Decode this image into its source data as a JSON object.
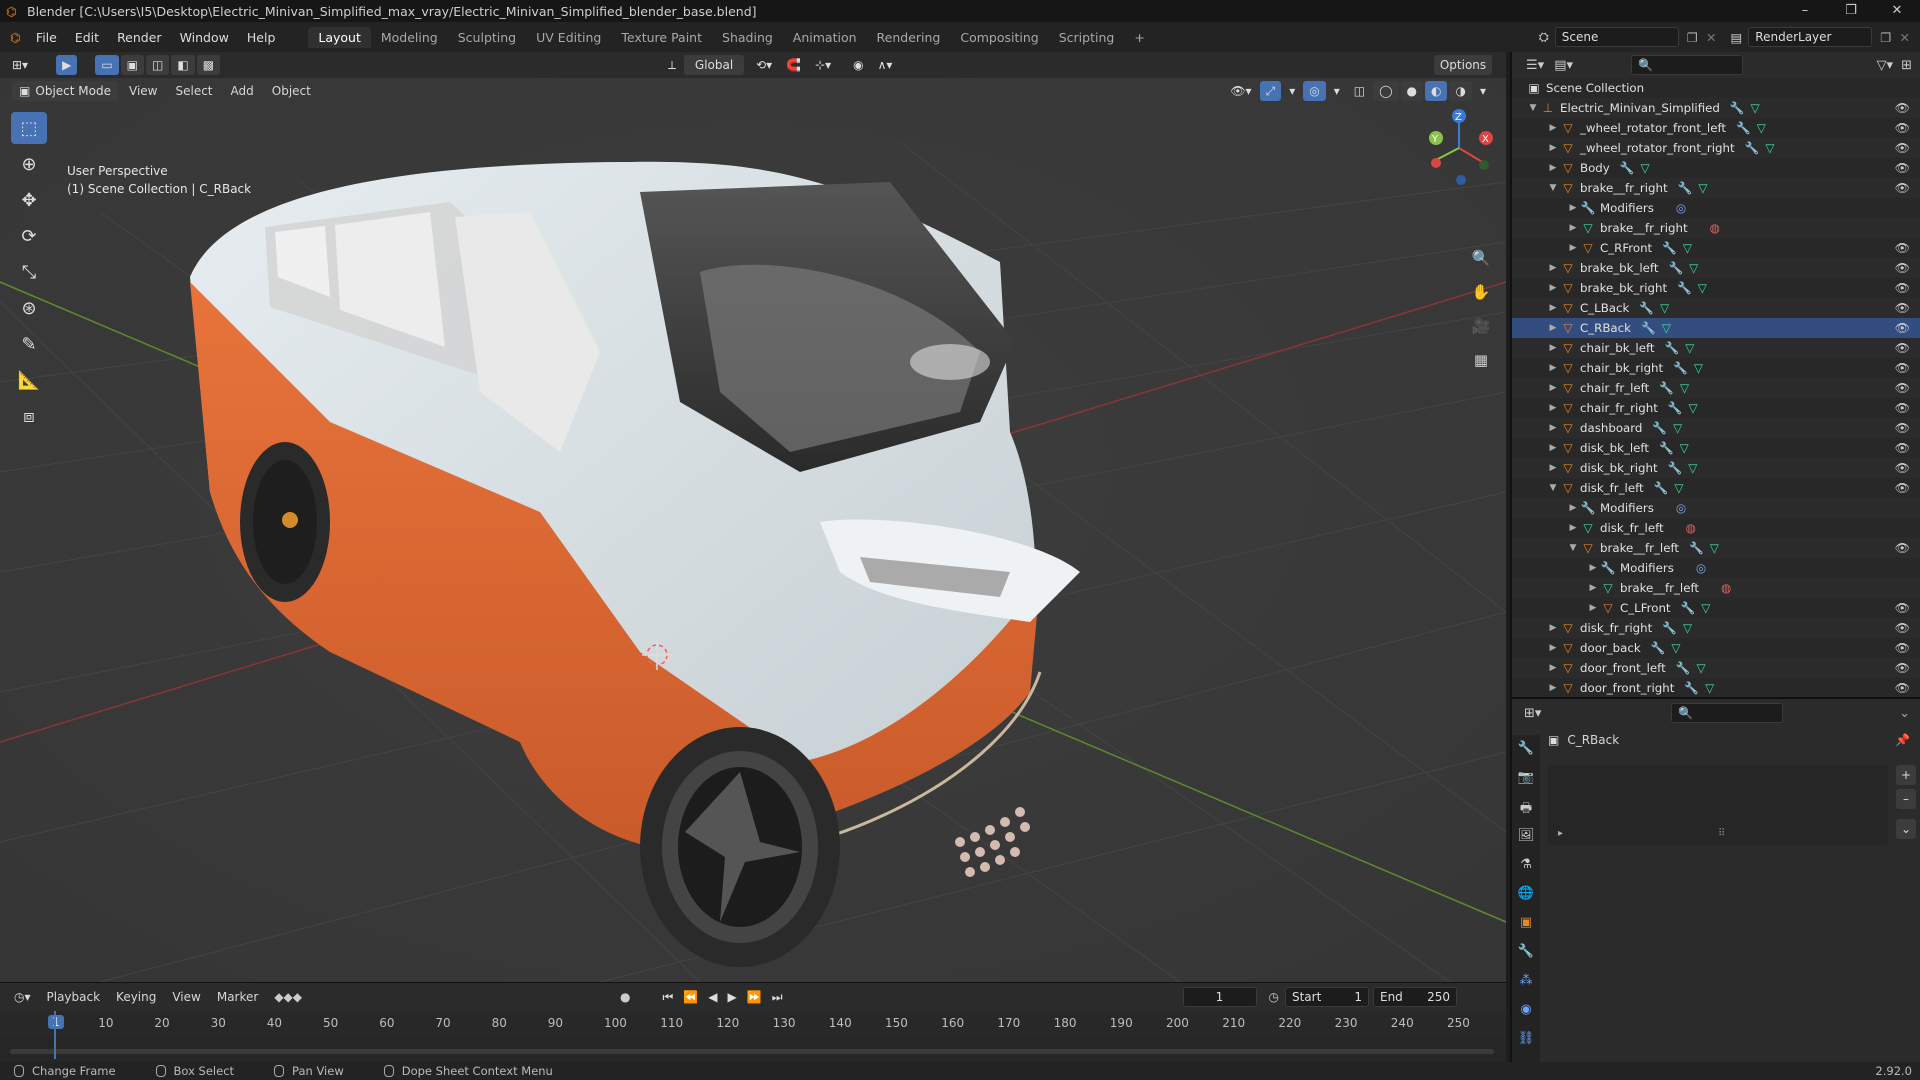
{
  "window": {
    "title": "Blender [C:\\Users\\I5\\Desktop\\Electric_Minivan_Simplified_max_vray/Electric_Minivan_Simplified_blender_base.blend]",
    "minimize": "–",
    "maximize": "❐",
    "close": "✕"
  },
  "menu": [
    "File",
    "Edit",
    "Render",
    "Window",
    "Help"
  ],
  "workspaces": [
    "Layout",
    "Modeling",
    "Sculpting",
    "UV Editing",
    "Texture Paint",
    "Shading",
    "Animation",
    "Rendering",
    "Compositing",
    "Scripting"
  ],
  "active_workspace": "Layout",
  "add_workspace": "+",
  "scene": {
    "name": "Scene",
    "render_layer": "RenderLayer"
  },
  "viewport": {
    "mode": "Object Mode",
    "menus": [
      "View",
      "Select",
      "Add",
      "Object"
    ],
    "transform_orientation": "Global",
    "options": "Options",
    "perspective_label": "User Perspective",
    "collection_label": "(1) Scene Collection | C_RBack",
    "gizmo_axes": {
      "x": "X",
      "y": "Y",
      "z": "Z"
    }
  },
  "timeline": {
    "menus": [
      "Playback",
      "Keying",
      "View",
      "Marker"
    ],
    "current_frame": "1",
    "start_label": "Start",
    "start": "1",
    "end_label": "End",
    "end": "250",
    "ticks": [
      "1",
      "10",
      "20",
      "30",
      "40",
      "50",
      "60",
      "70",
      "80",
      "90",
      "100",
      "110",
      "120",
      "130",
      "140",
      "150",
      "160",
      "170",
      "180",
      "190",
      "200",
      "210",
      "220",
      "230",
      "240",
      "250"
    ]
  },
  "statusbar": {
    "items": [
      "Change Frame",
      "Box Select",
      "Pan View",
      "Dope Sheet Context Menu"
    ],
    "version": "2.92.0"
  },
  "outliner": {
    "root": "Scene Collection",
    "rows": [
      {
        "label": "Electric_Minivan_Simplified",
        "type": "empty",
        "level": 1,
        "open": true
      },
      {
        "label": "_wheel_rotator_front_left",
        "type": "object",
        "level": 2
      },
      {
        "label": "_wheel_rotator_front_right",
        "type": "object",
        "level": 2
      },
      {
        "label": "Body",
        "type": "object",
        "level": 2
      },
      {
        "label": "brake__fr_right",
        "type": "object",
        "level": 2,
        "open": true
      },
      {
        "label": "Modifiers",
        "type": "modifiers",
        "level": 3
      },
      {
        "label": "brake__fr_right",
        "type": "mesh",
        "level": 3
      },
      {
        "label": "C_RFront",
        "type": "object",
        "level": 3
      },
      {
        "label": "brake_bk_left",
        "type": "object",
        "level": 2
      },
      {
        "label": "brake_bk_right",
        "type": "object",
        "level": 2
      },
      {
        "label": "C_LBack",
        "type": "object",
        "level": 2
      },
      {
        "label": "C_RBack",
        "type": "object",
        "level": 2,
        "selected": true
      },
      {
        "label": "chair_bk_left",
        "type": "object",
        "level": 2
      },
      {
        "label": "chair_bk_right",
        "type": "object",
        "level": 2
      },
      {
        "label": "chair_fr_left",
        "type": "object",
        "level": 2
      },
      {
        "label": "chair_fr_right",
        "type": "object",
        "level": 2
      },
      {
        "label": "dashboard",
        "type": "object",
        "level": 2
      },
      {
        "label": "disk_bk_left",
        "type": "object",
        "level": 2
      },
      {
        "label": "disk_bk_right",
        "type": "object",
        "level": 2
      },
      {
        "label": "disk_fr_left",
        "type": "object",
        "level": 2,
        "open": true
      },
      {
        "label": "Modifiers",
        "type": "modifiers",
        "level": 3
      },
      {
        "label": "disk_fr_left",
        "type": "mesh",
        "level": 3
      },
      {
        "label": "brake__fr_left",
        "type": "object",
        "level": 3,
        "open": true
      },
      {
        "label": "Modifiers",
        "type": "modifiers",
        "level": 4
      },
      {
        "label": "brake__fr_left",
        "type": "mesh",
        "level": 4
      },
      {
        "label": "C_LFront",
        "type": "object",
        "level": 4
      },
      {
        "label": "disk_fr_right",
        "type": "object",
        "level": 2
      },
      {
        "label": "door_back",
        "type": "object",
        "level": 2
      },
      {
        "label": "door_front_left",
        "type": "object",
        "level": 2
      },
      {
        "label": "door_front_right",
        "type": "object",
        "level": 2
      }
    ]
  },
  "properties": {
    "object_name": "C_RBack",
    "list_add": "+",
    "list_remove": "–",
    "list_more": "⌄",
    "list_expand": "▸",
    "list_grip": "⠿"
  },
  "colors": {
    "accent": "#4772b3",
    "object_orange": "#e0832c",
    "mesh_green": "#3fd9a0",
    "modifier_blue": "#7aa3e5",
    "van_orange": "#e06a35",
    "van_white": "#d8dfe3"
  }
}
